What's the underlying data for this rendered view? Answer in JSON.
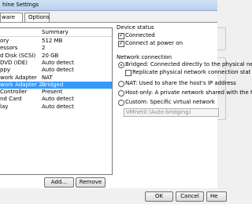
{
  "window": {
    "title": "hine Settings"
  },
  "tabs": [
    {
      "label": "ware"
    },
    {
      "label": "Options"
    }
  ],
  "hardware": {
    "columns": {
      "device": "",
      "summary": "Summary"
    },
    "rows": [
      {
        "device": "ory",
        "summary": "512 MB"
      },
      {
        "device": "essors",
        "summary": "2"
      },
      {
        "device": "d Disk (SCSI)",
        "summary": "20 GB"
      },
      {
        "device": "DVD (IDE)",
        "summary": "Auto detect"
      },
      {
        "device": "ppy",
        "summary": "Auto detect"
      },
      {
        "device": "work Adapter",
        "summary": "NAT"
      },
      {
        "device": "work Adapter 2",
        "summary": "Bridged"
      },
      {
        "device": "Controller",
        "summary": "Present"
      },
      {
        "device": "nd Card",
        "summary": "Auto detect"
      },
      {
        "device": "lay",
        "summary": "Auto detect"
      }
    ],
    "selected_index": 6,
    "add_label": "Add...",
    "remove_label": "Remove"
  },
  "device_status": {
    "title": "Device status",
    "connected": {
      "label": "Connected",
      "checked": true
    },
    "connect_power_on": {
      "label": "Connect at power on",
      "checked": true
    }
  },
  "network_connection": {
    "title": "Network connection",
    "bridged": {
      "label": "Bridged: Connected directly to the physical net",
      "selected": true
    },
    "replicate": {
      "label": "Replicate physical network connection stat",
      "checked": false
    },
    "nat": {
      "label": "NAT: Used to share the host's IP address",
      "selected": false
    },
    "host_only": {
      "label": "Host-only: A private network shared with the h",
      "selected": false
    },
    "custom": {
      "label": "Custom: Specific virtual network",
      "selected": false
    },
    "vmnet_select": {
      "value": "VMnet0 (Auto-bridging)"
    }
  },
  "footer": {
    "ok_label": "OK",
    "cancel_label": "Cancel",
    "help_label": "He"
  }
}
